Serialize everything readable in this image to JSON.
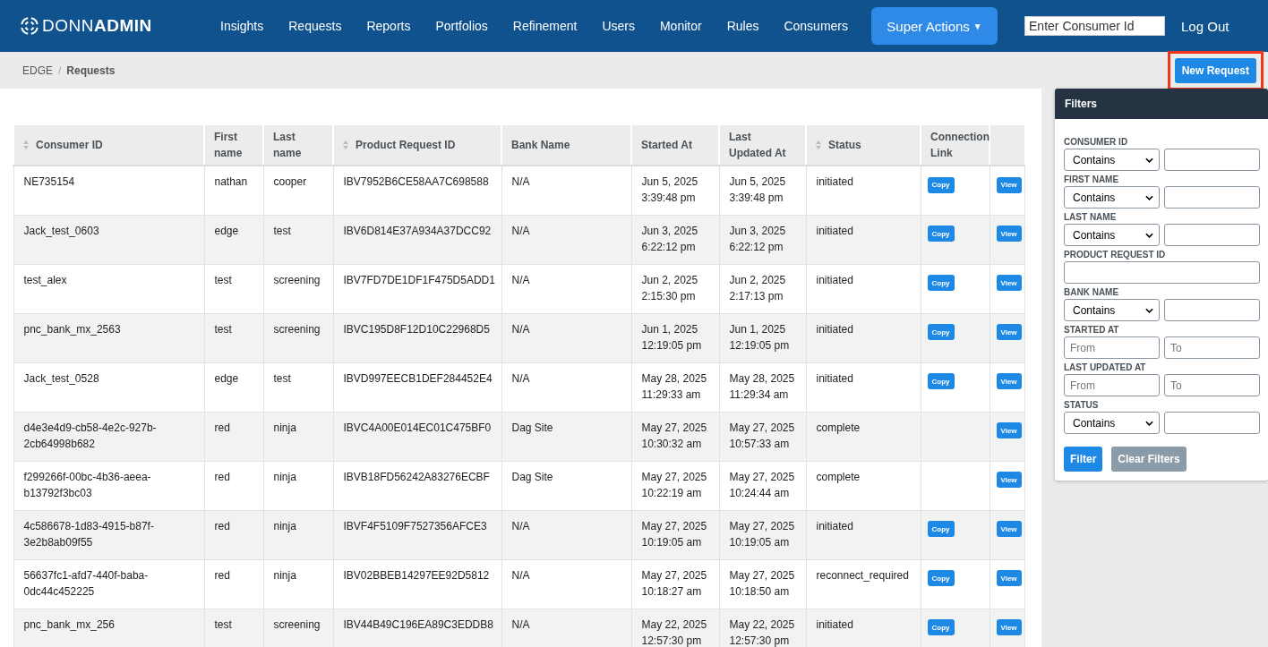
{
  "header": {
    "logo": "DONN**ADMIN**",
    "nav": [
      {
        "kind": "link",
        "label": "Insights"
      },
      {
        "kind": "link",
        "label": "Requests"
      },
      {
        "kind": "link",
        "label": "Reports"
      },
      {
        "kind": "link",
        "label": "Portfolios"
      },
      {
        "kind": "link",
        "label": "Refinement"
      },
      {
        "kind": "link",
        "label": "Users"
      },
      {
        "kind": "link",
        "label": "Monitor"
      },
      {
        "kind": "link",
        "label": "Rules"
      },
      {
        "kind": "link",
        "label": "Consumers"
      },
      {
        "kind": "dropdown",
        "label": "Super Actions",
        "caret": "▼"
      }
    ],
    "search": {
      "placeholder": "Enter Consumer Id"
    },
    "logout": "Log Out"
  },
  "breadcrumb": [
    {
      "label": "EDGE",
      "current": false
    },
    {
      "label": "Requests",
      "current": true
    }
  ],
  "breadcrumb_separator": "/",
  "new_request_button": {
    "label": "New Request",
    "highlighted": true
  },
  "table": {
    "columns": [
      {
        "label": "Consumer ID",
        "sortable": true
      },
      {
        "label": "First name",
        "sortable": false
      },
      {
        "label": "Last name",
        "sortable": false
      },
      {
        "label": "Product Request ID",
        "sortable": true
      },
      {
        "label": "Bank Name",
        "sortable": false
      },
      {
        "label": "Started At",
        "sortable": false
      },
      {
        "label": "Last Updated At",
        "sortable": false
      },
      {
        "label": "Status",
        "sortable": true
      },
      {
        "label": "Connection Link",
        "sortable": false
      }
    ],
    "rows": [
      {
        "cells": [
          "NE735154",
          "nathan",
          "cooper",
          "IBV7952B6CE58AA7C698588",
          "N/A",
          "Jun 5, 2025 3:39:48 pm",
          "Jun 5, 2025 3:39:48 pm",
          "initiated"
        ],
        "copy": "Copy",
        "view": "View"
      },
      {
        "cells": [
          "Jack_test_0603",
          "edge",
          "test",
          "IBV6D814E37A934A37DCC92",
          "N/A",
          "Jun 3, 2025 6:22:12 pm",
          "Jun 3, 2025 6:22:12 pm",
          "initiated"
        ],
        "copy": "Copy",
        "view": "View"
      },
      {
        "cells": [
          "test_alex",
          "test",
          "screening",
          "IBV7FD7DE1DF1F475D5ADD1",
          "N/A",
          "Jun 2, 2025 2:15:30 pm",
          "Jun 2, 2025 2:17:13 pm",
          "initiated"
        ],
        "copy": "Copy",
        "view": "View"
      },
      {
        "cells": [
          "pnc_bank_mx_2563",
          "test",
          "screening",
          "IBVC195D8F12D10C22968D5",
          "N/A",
          "Jun 1, 2025 12:19:05 pm",
          "Jun 1, 2025 12:19:05 pm",
          "initiated"
        ],
        "copy": "Copy",
        "view": "View"
      },
      {
        "cells": [
          "Jack_test_0528",
          "edge",
          "test",
          "IBVD997EECB1DEF284452E4",
          "N/A",
          "May 28, 2025 11:29:33 am",
          "May 28, 2025 11:29:34 am",
          "initiated"
        ],
        "copy": "Copy",
        "view": "View"
      },
      {
        "cells": [
          "d4e3e4d9-cb58-4e2c-927b-2cb64998b682",
          "red",
          "ninja",
          "IBVC4A00E014EC01C475BF0",
          "Dag Site",
          "May 27, 2025 10:30:32 am",
          "May 27, 2025 10:57:33 am",
          "complete"
        ],
        "view": "View"
      },
      {
        "cells": [
          "f299266f-00bc-4b36-aeea-b13792f3bc03",
          "red",
          "ninja",
          "IBVB18FD56242A83276ECBF",
          "Dag Site",
          "May 27, 2025 10:22:19 am",
          "May 27, 2025 10:24:44 am",
          "complete"
        ],
        "view": "View"
      },
      {
        "cells": [
          "4c586678-1d83-4915-b87f-3e2b8ab09f55",
          "red",
          "ninja",
          "IBVF4F5109F7527356AFCE3",
          "N/A",
          "May 27, 2025 10:19:05 am",
          "May 27, 2025 10:19:05 am",
          "initiated"
        ],
        "copy": "Copy",
        "view": "View"
      },
      {
        "cells": [
          "56637fc1-afd7-440f-baba-0dc44c452225",
          "red",
          "ninja",
          "IBV02BBEB14297EE92D5812",
          "N/A",
          "May 27, 2025 10:18:27 am",
          "May 27, 2025 10:18:50 am",
          "reconnect_required"
        ],
        "copy": "Copy",
        "view": "View"
      },
      {
        "cells": [
          "pnc_bank_mx_256",
          "test",
          "screening",
          "IBV44B49C196EA89C3EDDB8",
          "N/A",
          "May 22, 2025 12:57:30 pm",
          "May 22, 2025 12:57:30 pm",
          "initiated"
        ],
        "copy": "Copy",
        "view": "View"
      }
    ]
  },
  "filters": {
    "title": "Filters",
    "fields": [
      {
        "kind": "match",
        "label": "CONSUMER ID",
        "option": "Contains"
      },
      {
        "kind": "match",
        "label": "FIRST NAME",
        "option": "Contains"
      },
      {
        "kind": "match",
        "label": "LAST NAME",
        "option": "Contains"
      },
      {
        "kind": "text",
        "label": "PRODUCT REQUEST ID"
      },
      {
        "kind": "match",
        "label": "BANK NAME",
        "option": "Contains"
      },
      {
        "kind": "range",
        "label": "STARTED AT",
        "from_placeholder": "From",
        "to_placeholder": "To"
      },
      {
        "kind": "range",
        "label": "LAST UPDATED AT",
        "from_placeholder": "From",
        "to_placeholder": "To"
      },
      {
        "kind": "match",
        "label": "STATUS",
        "option": "Contains"
      }
    ],
    "filter_button": "Filter",
    "clear_button": "Clear Filters"
  }
}
